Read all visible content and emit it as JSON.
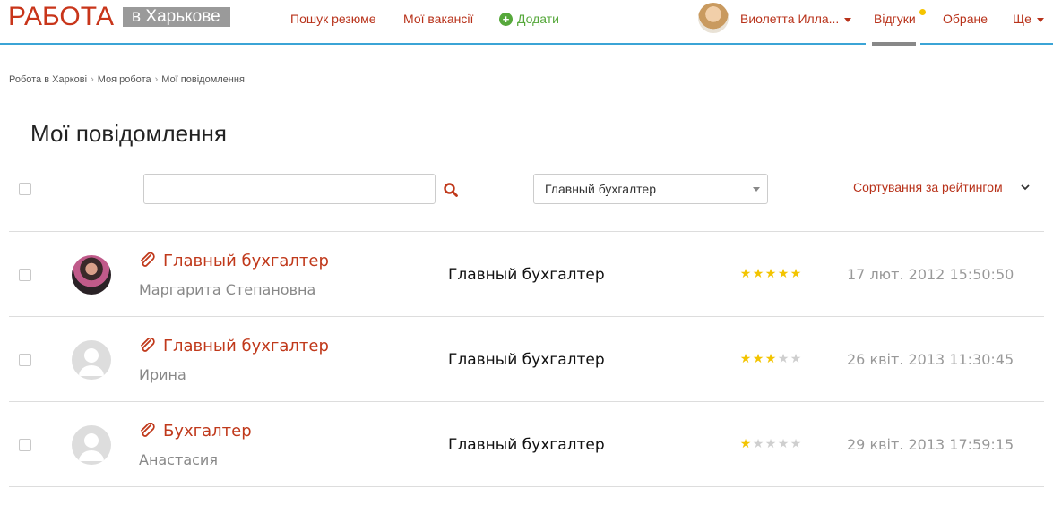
{
  "header": {
    "logo_main": "РАБОТА",
    "logo_city": "в Харькове",
    "nav": {
      "search_resume": "Пошук резюме",
      "my_vacancies": "Мої вакансії",
      "add": "Додати",
      "user_name": "Виолетта Илла...",
      "responses": "Відгуки",
      "favorites": "Обране",
      "more": "Ще"
    }
  },
  "breadcrumbs": [
    "Робота в Харкові",
    "Моя робота",
    "Мої повідомлення"
  ],
  "page": {
    "title": "Мої повідомлення",
    "search_placeholder": "",
    "filter_selected": "Главный бухгалтер",
    "sort_label": "Сортування за рейтингом"
  },
  "colors": {
    "accent": "#c0391b",
    "header_line": "#3ba4d6",
    "add_green": "#56a83b",
    "star": "#f3c400"
  },
  "messages": [
    {
      "title": "Главный бухгалтер",
      "author": "Маргарита Степановна",
      "vacancy": "Главный бухгалтер",
      "rating": 5,
      "date": "17 лют. 2012 15:50:50",
      "avatar": "photo"
    },
    {
      "title": "Главный бухгалтер",
      "author": "Ирина",
      "vacancy": "Главный бухгалтер",
      "rating": 3,
      "date": "26 квіт. 2013 11:30:45",
      "avatar": "default"
    },
    {
      "title": "Бухгалтер",
      "author": "Анастасия",
      "vacancy": "Главный бухгалтер",
      "rating": 1,
      "date": "29 квіт. 2013 17:59:15",
      "avatar": "default"
    }
  ]
}
